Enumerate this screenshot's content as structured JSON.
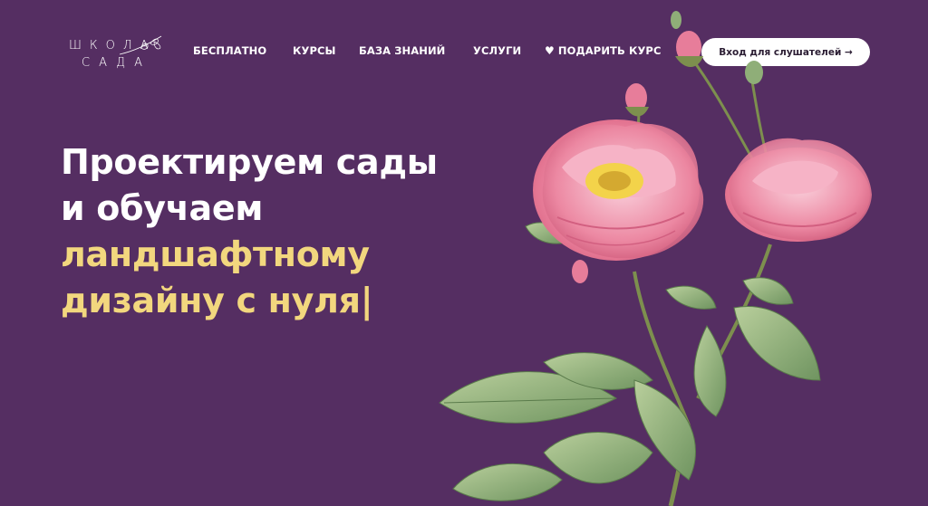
{
  "logo": {
    "line1": "ШКОЛА",
    "line2": "САДА"
  },
  "nav": {
    "items": [
      {
        "label": "БЕСПЛАТНО"
      },
      {
        "label": "КУРСЫ"
      },
      {
        "label": "БАЗА ЗНАНИЙ"
      },
      {
        "label": "УСЛУГИ"
      },
      {
        "label": "ПОДАРИТЬ КУРС",
        "icon": "heart-icon"
      }
    ],
    "login_label": "Вход для слушателей →"
  },
  "hero": {
    "line1": "Проектируем сады",
    "line2": "и обучаем",
    "line3": "ландшафтному",
    "line4": "дизайну с нуля|"
  },
  "colors": {
    "background": "#552e62",
    "accent_yellow": "#f2d77e",
    "white": "#ffffff",
    "rose_pink": "#ee8aa5",
    "leaf_green": "#8fae78"
  }
}
